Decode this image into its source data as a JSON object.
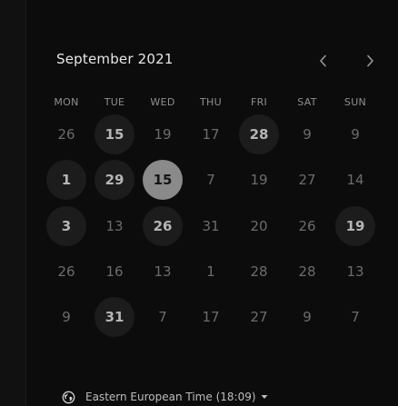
{
  "calendar": {
    "month_label": "September 2021",
    "weekdays": [
      "MON",
      "TUE",
      "WED",
      "THU",
      "FRI",
      "SAT",
      "SUN"
    ],
    "weeks": [
      [
        {
          "d": "26",
          "s": "dim"
        },
        {
          "d": "15",
          "s": "mark"
        },
        {
          "d": "19",
          "s": "dim"
        },
        {
          "d": "17",
          "s": "dim"
        },
        {
          "d": "28",
          "s": "mark"
        },
        {
          "d": "9",
          "s": "dim"
        },
        {
          "d": "9",
          "s": "dim"
        }
      ],
      [
        {
          "d": "1",
          "s": "mark"
        },
        {
          "d": "29",
          "s": "mark"
        },
        {
          "d": "15",
          "s": "sel"
        },
        {
          "d": "7",
          "s": "dim"
        },
        {
          "d": "19",
          "s": "dim"
        },
        {
          "d": "27",
          "s": "dim"
        },
        {
          "d": "14",
          "s": "dim"
        }
      ],
      [
        {
          "d": "3",
          "s": "mark"
        },
        {
          "d": "13",
          "s": "dim"
        },
        {
          "d": "26",
          "s": "mark"
        },
        {
          "d": "31",
          "s": "dim"
        },
        {
          "d": "20",
          "s": "dim"
        },
        {
          "d": "26",
          "s": "dim"
        },
        {
          "d": "19",
          "s": "mark"
        }
      ],
      [
        {
          "d": "26",
          "s": "dim"
        },
        {
          "d": "16",
          "s": "dim"
        },
        {
          "d": "13",
          "s": "dim"
        },
        {
          "d": "1",
          "s": "dim"
        },
        {
          "d": "28",
          "s": "dim"
        },
        {
          "d": "28",
          "s": "dim"
        },
        {
          "d": "13",
          "s": "dim"
        }
      ],
      [
        {
          "d": "9",
          "s": "dim"
        },
        {
          "d": "31",
          "s": "mark"
        },
        {
          "d": "7",
          "s": "dim"
        },
        {
          "d": "17",
          "s": "dim"
        },
        {
          "d": "27",
          "s": "dim"
        },
        {
          "d": "9",
          "s": "dim"
        },
        {
          "d": "7",
          "s": "dim"
        }
      ]
    ]
  },
  "navigation": {
    "prev_icon": "chevron-left-icon",
    "next_icon": "chevron-right-icon"
  },
  "timezone": {
    "label": "Eastern European Time (18:09)",
    "icon": "globe-icon",
    "caret_icon": "caret-down-icon"
  },
  "colors": {
    "background": "#0c0c0c",
    "marked_day_bg": "#1c1c1c",
    "selected_day_bg": "#8a8a8a",
    "dim_text": "#6c6c6c",
    "bright_text": "#e7e7e7"
  }
}
